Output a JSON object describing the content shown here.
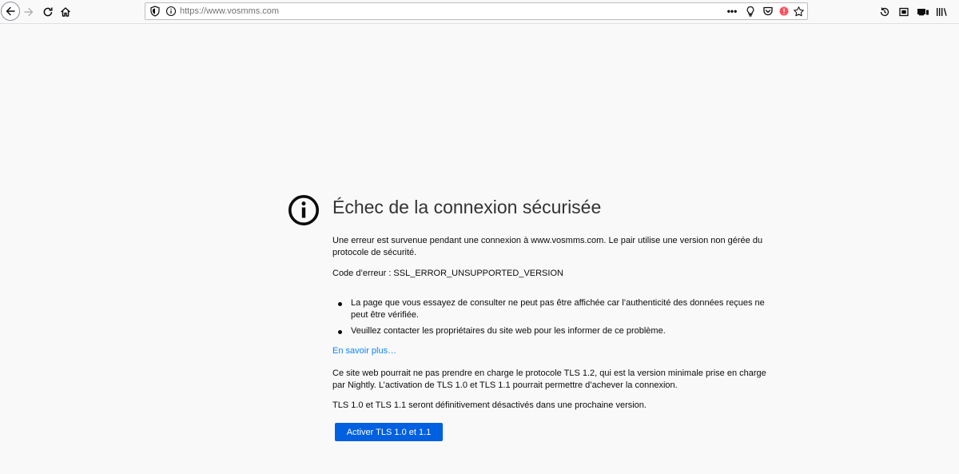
{
  "browser": {
    "url": "https://www.vosmms.com",
    "page_actions_label": "•••",
    "icons": {
      "back": "back-arrow-icon",
      "forward": "forward-arrow-icon",
      "reload": "reload-icon",
      "home": "home-icon",
      "tracking": "tracking-protection-shield-icon",
      "info": "site-info-icon",
      "bulb": "lightbulb-icon",
      "pocket": "pocket-icon",
      "blocked": "blocked-notice-icon",
      "bookmark": "bookmark-star-icon",
      "history": "history-icon",
      "screenshot": "screenshot-icon",
      "tabs": "synced-tabs-icon",
      "library": "library-icon"
    }
  },
  "error": {
    "title": "Échec de la connexion sécurisée",
    "description": "Une erreur est survenue pendant une connexion à www.vosmms.com. Le pair utilise une version non gérée du protocole de sécurité.",
    "code": "Code d’erreur : SSL_ERROR_UNSUPPORTED_VERSION",
    "reasons": [
      "La page que vous essayez de consulter ne peut pas être affichée car l’authenticité des données reçues ne peut être vérifiée.",
      "Veuillez contacter les propriétaires du site web pour les informer de ce problème."
    ],
    "learn_more": "En savoir plus…",
    "tls_message": "Ce site web pourrait ne pas prendre en charge le protocole TLS 1.2, qui est la version minimale prise en charge par Nightly. L’activation de TLS 1.0 et TLS 1.1 pourrait permettre d’achever la connexion.",
    "tls_deprecation": "TLS 1.0 et TLS 1.1 seront définitivement désactivés dans une prochaine version.",
    "button_label": "Activer TLS 1.0 et 1.1"
  },
  "colors": {
    "accent": "#0060df",
    "link": "#0a84ff",
    "background": "#f9f9fa"
  }
}
